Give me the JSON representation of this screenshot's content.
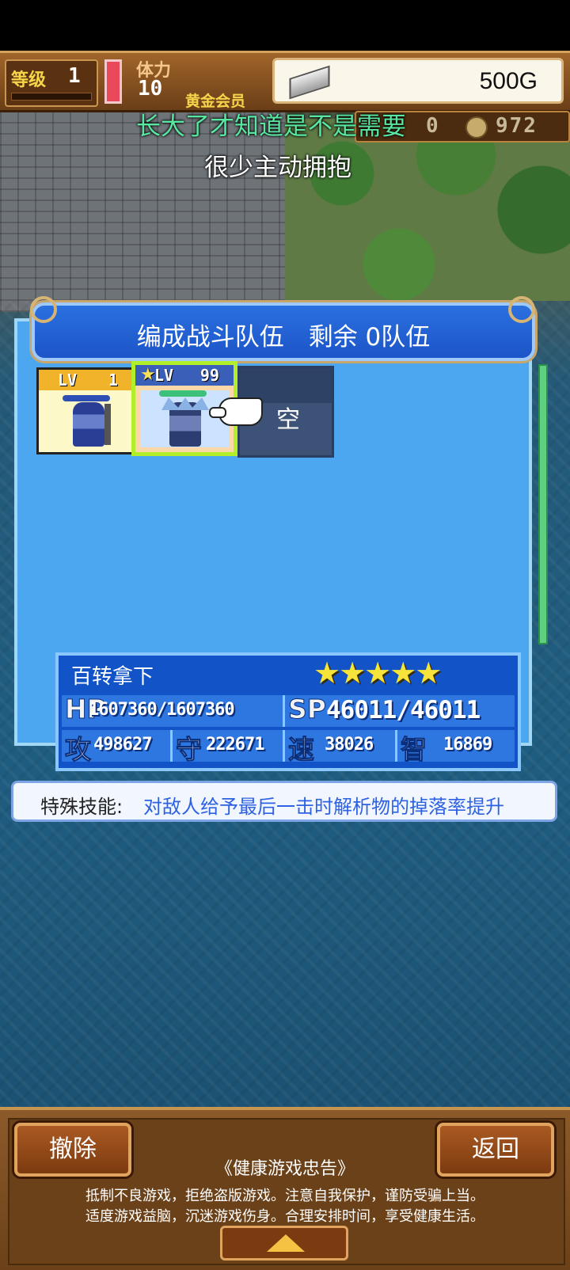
{
  "hud": {
    "level_label": "等级",
    "level_value": "1",
    "stamina_label": "体力",
    "stamina_value": "10",
    "vip_label": "黄金会员",
    "gold": "500G",
    "coins_left": "0",
    "coins_right": "972"
  },
  "lyrics": {
    "line1": "长大了才知道是不是需要",
    "line2": "很少主动拥抱"
  },
  "party": {
    "title": "编成战斗队伍　剩余 0队伍",
    "slots": [
      {
        "lv_label": "LV",
        "lv_value": "1"
      },
      {
        "lv_label": "LV",
        "lv_value": "99",
        "star": "★"
      },
      {
        "empty_label": "空"
      }
    ]
  },
  "character": {
    "name": "百转拿下",
    "stars": "★★★★★",
    "hp_label": "HP",
    "hp_value": "1607360/1607360",
    "sp_label": "SP",
    "sp_value": "46011/46011",
    "atk_label": "攻",
    "atk_value": "498627",
    "def_label": "守",
    "def_value": "222671",
    "spd_label": "速",
    "spd_value": "38026",
    "int_label": "智",
    "int_value": "16869"
  },
  "skill": {
    "label": "特殊技能:",
    "text": "对敌人给予最后一击时解析物的掉落率提升"
  },
  "bottom": {
    "left_button": "撤除",
    "right_button": "返回",
    "notice_title": "《健康游戏忠告》",
    "notice_line1": "抵制不良游戏，拒绝盗版游戏。注意自我保护，谨防受骗上当。",
    "notice_line2": "适度游戏益脑，沉迷游戏伤身。合理安排时间，享受健康生活。"
  },
  "colors": {
    "panel": "#4da7f0",
    "header": "#1c55c8",
    "selected_border": "#b2ef2a",
    "lyric": "#58e7a0"
  }
}
